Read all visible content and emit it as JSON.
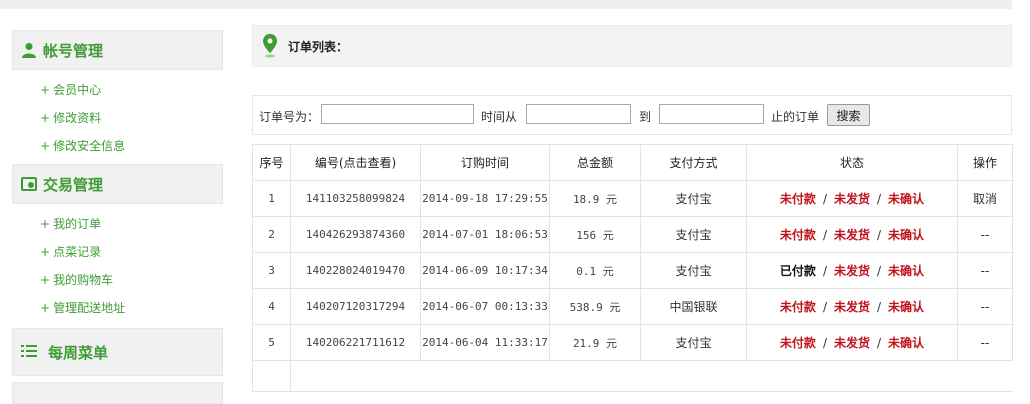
{
  "sidebar": {
    "sections": [
      {
        "title": "帐号管理",
        "icon": "user-icon",
        "items": [
          "会员中心",
          "修改资料",
          "修改安全信息"
        ]
      },
      {
        "title": "交易管理",
        "icon": "trade-icon",
        "items": [
          "我的订单",
          "点菜记录",
          "我的购物车",
          "管理配送地址"
        ]
      },
      {
        "title": "每周菜单",
        "icon": "list-icon",
        "items": []
      }
    ],
    "plus": "+"
  },
  "header": {
    "title": "订单列表：",
    "icon": "location-pin-icon"
  },
  "search": {
    "order_no_label": "订单号为：",
    "time_from_label": "时间从",
    "to_label": "到",
    "until_label": "止的订单",
    "button_label": "搜索",
    "order_no_value": "",
    "from_value": "",
    "to_value": ""
  },
  "table": {
    "columns": [
      "序号",
      "编号(点击查看)",
      "订购时间",
      "总金额",
      "支付方式",
      "状态",
      "操作"
    ],
    "rows": [
      {
        "index": "1",
        "number": "141103258099824",
        "time": "2014-09-18 17:29:55",
        "amount": "18.9 元",
        "payment": "支付宝",
        "pay_status": "未付款",
        "ship_status": "未发货",
        "confirm_status": "未确认",
        "action": "取消"
      },
      {
        "index": "2",
        "number": "140426293874360",
        "time": "2014-07-01 18:06:53",
        "amount": "156 元",
        "payment": "支付宝",
        "pay_status": "未付款",
        "ship_status": "未发货",
        "confirm_status": "未确认",
        "action": "--"
      },
      {
        "index": "3",
        "number": "140228024019470",
        "time": "2014-06-09 10:17:34",
        "amount": "0.1 元",
        "payment": "支付宝",
        "pay_status": "已付款",
        "ship_status": "未发货",
        "confirm_status": "未确认",
        "action": "--"
      },
      {
        "index": "4",
        "number": "140207120317294",
        "time": "2014-06-07 00:13:33",
        "amount": "538.9 元",
        "payment": "中国银联",
        "pay_status": "未付款",
        "ship_status": "未发货",
        "confirm_status": "未确认",
        "action": "--"
      },
      {
        "index": "5",
        "number": "140206221711612",
        "time": "2014-06-04 11:33:17",
        "amount": "21.9 元",
        "payment": "支付宝",
        "pay_status": "未付款",
        "ship_status": "未发货",
        "confirm_status": "未确认",
        "action": "--"
      }
    ],
    "separator": "/"
  },
  "colors": {
    "green": "#3f9c35",
    "red": "#c0141c"
  }
}
